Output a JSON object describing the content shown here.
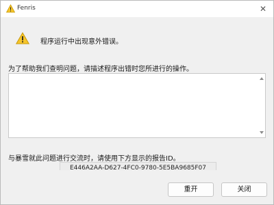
{
  "window": {
    "title": "Fenris",
    "close_glyph": "✕",
    "title_icon": "warning-icon"
  },
  "content": {
    "warning_icon": "warning-icon",
    "heading": "程序运行中出现意外错误。",
    "instruction": "为了帮助我们查明问题，请描述程序出错时您所进行的操作。",
    "description_value": "",
    "report_label": "与暴雪就此问题进行交流时，请使用下方显示的报告ID。",
    "report_id": "E446A2AA-D627-4FC0-9780-5E5BA9685F07"
  },
  "buttons": {
    "restart_label": "重开",
    "close_label": "关闭"
  },
  "colors": {
    "warning_yellow": "#f6c52a",
    "warning_outline": "#c89a0c",
    "dialog_bg": "#f0f0f0"
  }
}
